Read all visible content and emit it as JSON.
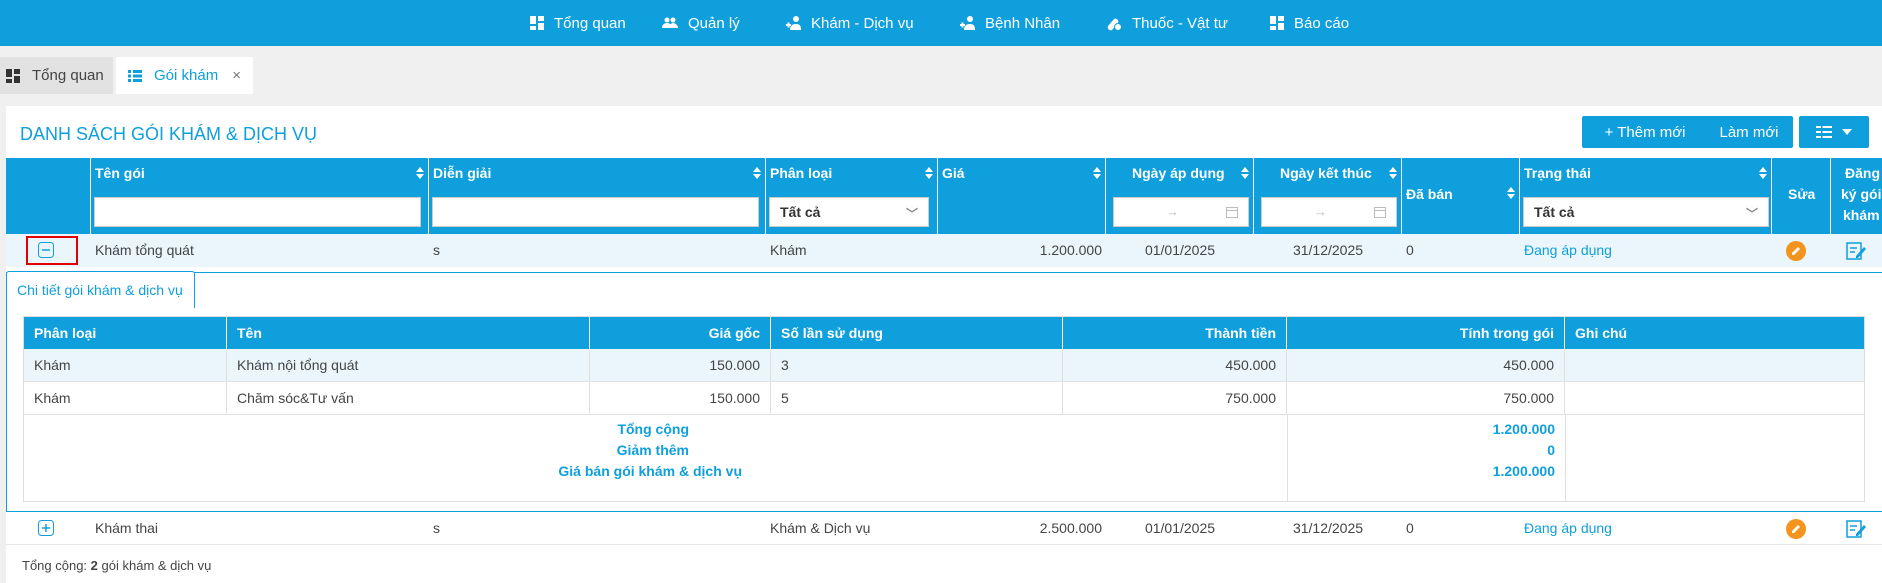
{
  "nav": {
    "items": [
      {
        "label": "Tổng quan",
        "icon": "dashboard-icon"
      },
      {
        "label": "Quản lý",
        "icon": "users-icon"
      },
      {
        "label": "Khám - Dịch vụ",
        "icon": "patient-icon"
      },
      {
        "label": "Bệnh Nhân",
        "icon": "patient-icon"
      },
      {
        "label": "Thuốc - Vật tư",
        "icon": "medicine-icon"
      },
      {
        "label": "Báo cáo",
        "icon": "report-icon"
      }
    ]
  },
  "tabs": {
    "overview": "Tổng quan",
    "active": "Gói khám",
    "close": "×"
  },
  "panel": {
    "title": "DANH SÁCH GÓI KHÁM & DỊCH VỤ",
    "add_label": "+ Thêm mới",
    "refresh_label": "Làm mới"
  },
  "table": {
    "columns": {
      "name": "Tên gói",
      "desc": "Diễn giải",
      "type": "Phân loại",
      "price": "Giá",
      "start": "Ngày áp dụng",
      "end": "Ngày kết thúc",
      "sold": "Đã bán",
      "status": "Trạng thái",
      "edit": "Sửa",
      "register_1": "Đăng",
      "register_2": "ký gói",
      "register_3": "khám"
    },
    "filters": {
      "type": "Tất cả",
      "status": "Tất cả",
      "date_arrow": "→"
    },
    "rows": [
      {
        "name": "Khám tổng quát",
        "desc": "s",
        "type": "Khám",
        "price": "1.200.000",
        "start": "01/01/2025",
        "end": "31/12/2025",
        "sold": "0",
        "status": "Đang áp dụng"
      },
      {
        "name": "Khám thai",
        "desc": "s",
        "type": "Khám & Dịch vụ",
        "price": "2.500.000",
        "start": "01/01/2025",
        "end": "31/12/2025",
        "sold": "0",
        "status": "Đang áp dụng"
      }
    ]
  },
  "detail": {
    "tab_label": "Chi tiết gói khám & dịch vụ",
    "columns": {
      "type": "Phân loại",
      "name": "Tên",
      "base_price": "Giá gốc",
      "uses": "Số lần sử dụng",
      "amount": "Thành tiền",
      "in_package": "Tính trong gói",
      "note": "Ghi chú"
    },
    "rows": [
      {
        "type": "Khám",
        "name": "Khám nội tổng quát",
        "base_price": "150.000",
        "uses": "3",
        "amount": "450.000",
        "in_package": "450.000"
      },
      {
        "type": "Khám",
        "name": "Chăm sóc&Tư vấn",
        "base_price": "150.000",
        "uses": "5",
        "amount": "750.000",
        "in_package": "750.000"
      }
    ],
    "summary": {
      "total_label": "Tổng cộng",
      "discount_label": "Giảm thêm",
      "sale_label": "Giá bán gói khám & dịch vụ",
      "total_value": "1.200.000",
      "discount_value": "0",
      "sale_value": "1.200.000"
    }
  },
  "footer": {
    "prefix": "Tổng cộng:",
    "count": "2",
    "suffix": "gói khám & dịch vụ"
  },
  "colors": {
    "primary": "#0f9fdc",
    "edit": "#f3941e",
    "highlight": "#e00000"
  }
}
